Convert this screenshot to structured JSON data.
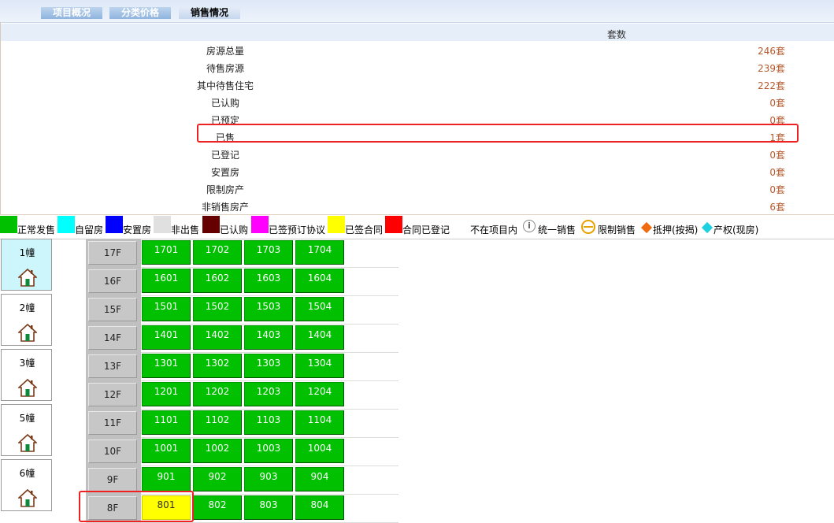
{
  "tabs": [
    {
      "label": "项目概况",
      "active": false
    },
    {
      "label": "分类价格",
      "active": false
    },
    {
      "label": "销售情况",
      "active": true
    }
  ],
  "summary": {
    "header": "套数",
    "rows": [
      {
        "label": "房源总量",
        "value": "246套"
      },
      {
        "label": "待售房源",
        "value": "239套"
      },
      {
        "label": "其中待售住宅",
        "value": "222套"
      },
      {
        "label": "已认购",
        "value": "0套"
      },
      {
        "label": "已预定",
        "value": "0套"
      },
      {
        "label": "已售",
        "value": "1套"
      },
      {
        "label": "已登记",
        "value": "0套"
      },
      {
        "label": "安置房",
        "value": "0套"
      },
      {
        "label": "限制房产",
        "value": "0套"
      },
      {
        "label": "非销售房产",
        "value": "6套"
      }
    ]
  },
  "legend": [
    {
      "label": "正常发售",
      "color": "#00c000"
    },
    {
      "label": "自留房",
      "color": "#00ffff"
    },
    {
      "label": "安置房",
      "color": "#0000ff"
    },
    {
      "label": "非出售",
      "color": "#e0e0e0"
    },
    {
      "label": "已认购",
      "color": "#660000"
    },
    {
      "label": "已签预订协议",
      "color": "#ff00ff"
    },
    {
      "label": "已签合同",
      "color": "#ffff00"
    },
    {
      "label": "合同已登记",
      "color": "#ff0000"
    },
    {
      "label": "不在项目内",
      "color": "#ffffff"
    },
    {
      "label": "统一销售",
      "icon": "info-circle-icon"
    },
    {
      "label": "限制销售",
      "icon": "limit-circle-icon"
    },
    {
      "label": "抵押(按揭)",
      "icon": "orange-diamond-icon",
      "color": "#f06a10"
    },
    {
      "label": "产权(现房)",
      "icon": "cyan-diamond-icon",
      "color": "#1fd0e0"
    }
  ],
  "buildings": [
    {
      "label": "1幢",
      "active": true
    },
    {
      "label": "2幢",
      "active": false
    },
    {
      "label": "3幢",
      "active": false
    },
    {
      "label": "5幢",
      "active": false
    },
    {
      "label": "6幢",
      "active": false
    }
  ],
  "floors": [
    {
      "label": "17F",
      "units": [
        "1701",
        "1702",
        "1703",
        "1704"
      ]
    },
    {
      "label": "16F",
      "units": [
        "1601",
        "1602",
        "1603",
        "1604"
      ]
    },
    {
      "label": "15F",
      "units": [
        "1501",
        "1502",
        "1503",
        "1504"
      ]
    },
    {
      "label": "14F",
      "units": [
        "1401",
        "1402",
        "1403",
        "1404"
      ]
    },
    {
      "label": "13F",
      "units": [
        "1301",
        "1302",
        "1303",
        "1304"
      ]
    },
    {
      "label": "12F",
      "units": [
        "1201",
        "1202",
        "1203",
        "1204"
      ]
    },
    {
      "label": "11F",
      "units": [
        "1101",
        "1102",
        "1103",
        "1104"
      ]
    },
    {
      "label": "10F",
      "units": [
        "1001",
        "1002",
        "1003",
        "1004"
      ]
    },
    {
      "label": "9F",
      "units": [
        "901",
        "902",
        "903",
        "904"
      ]
    },
    {
      "label": "8F",
      "units": [
        "801",
        "802",
        "803",
        "804"
      ],
      "yellow_unit": "801"
    }
  ]
}
